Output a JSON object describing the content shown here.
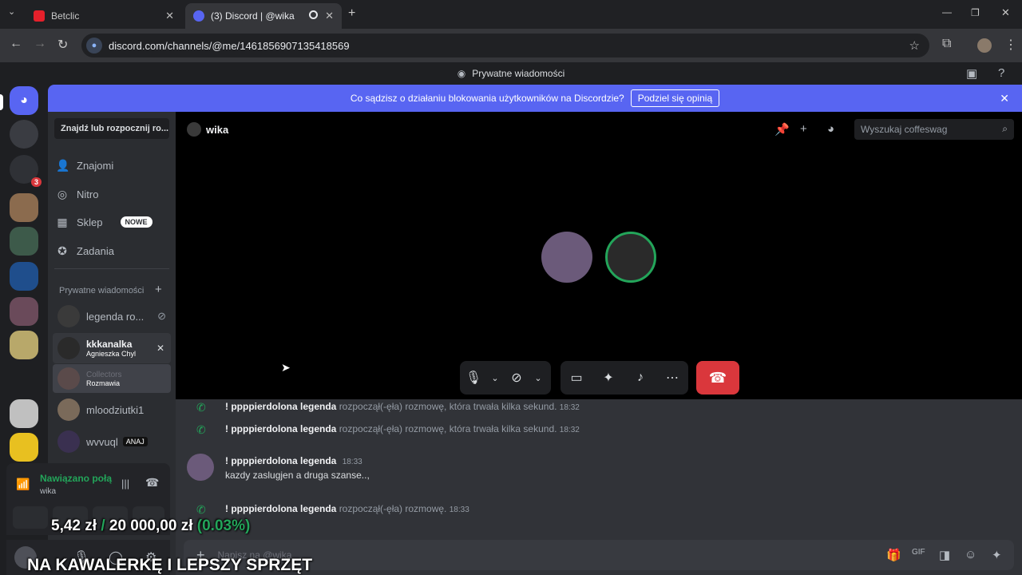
{
  "browser": {
    "tabs": [
      {
        "title": "Betclic"
      },
      {
        "title": "(3) Discord | @wika"
      }
    ],
    "url": "discord.com/channels/@me/1461856907135418569"
  },
  "discord": {
    "top_title": "Prywatne wiadomości",
    "banner_text": "Co sądzisz o działaniu blokowania użytkowników na Discordzie?",
    "banner_button": "Podziel się opinią",
    "server_badge": "3",
    "dm_search": "Znajdź lub rozpocznij ro...",
    "nav": {
      "friends": "Znajomi",
      "nitro": "Nitro",
      "shop": "Sklep",
      "shop_badge": "NOWE",
      "quests": "Zadania"
    },
    "dm_header": "Prywatne wiadomości",
    "dms": [
      {
        "name": "legenda ro...",
        "sub": ""
      },
      {
        "name": "kkkanalka",
        "sub": "Agnieszka Chyl"
      },
      {
        "name": "Collectors",
        "sub": "Rozmawia"
      },
      {
        "name": "mloodziutki1",
        "sub": ""
      },
      {
        "name": "wvvuql",
        "sub": "ANAJ"
      }
    ],
    "channel_name": "wika",
    "search_placeholder": "Wyszukaj coffeswag",
    "messages": [
      {
        "author": "! ppppierdolona legenda",
        "text": "rozpoczął(-ęła) rozmowę, która trwała kilka sekund.",
        "time": "18:32"
      },
      {
        "author": "! ppppierdolona legenda",
        "text": "rozpoczął(-ęła) rozmowę, która trwała kilka sekund.",
        "time": "18:32"
      },
      {
        "author": "! ppppierdolona legenda",
        "time": "18:33",
        "body": "kazdy zaslugjen a druga szanse..,"
      },
      {
        "author": "! ppppierdolona legenda",
        "text": "rozpoczął(-ęła) rozmowę.",
        "time": "18:33"
      }
    ],
    "composer_placeholder": "Napisz na @wika",
    "voice": {
      "status": "Nawiązano połą",
      "channel": "wika"
    }
  },
  "overlay": {
    "donation_amount": "5,42 zł",
    "donation_sep": "/",
    "donation_goal": "20 000,00 zł",
    "donation_pct": "(0.03%)",
    "bottom_caption": "NA KAWALERKĘ I LEPSZY SPRZĘT"
  },
  "colors": {
    "blurple": "#5865f2",
    "danger": "#da373c",
    "online": "#23a55a"
  }
}
